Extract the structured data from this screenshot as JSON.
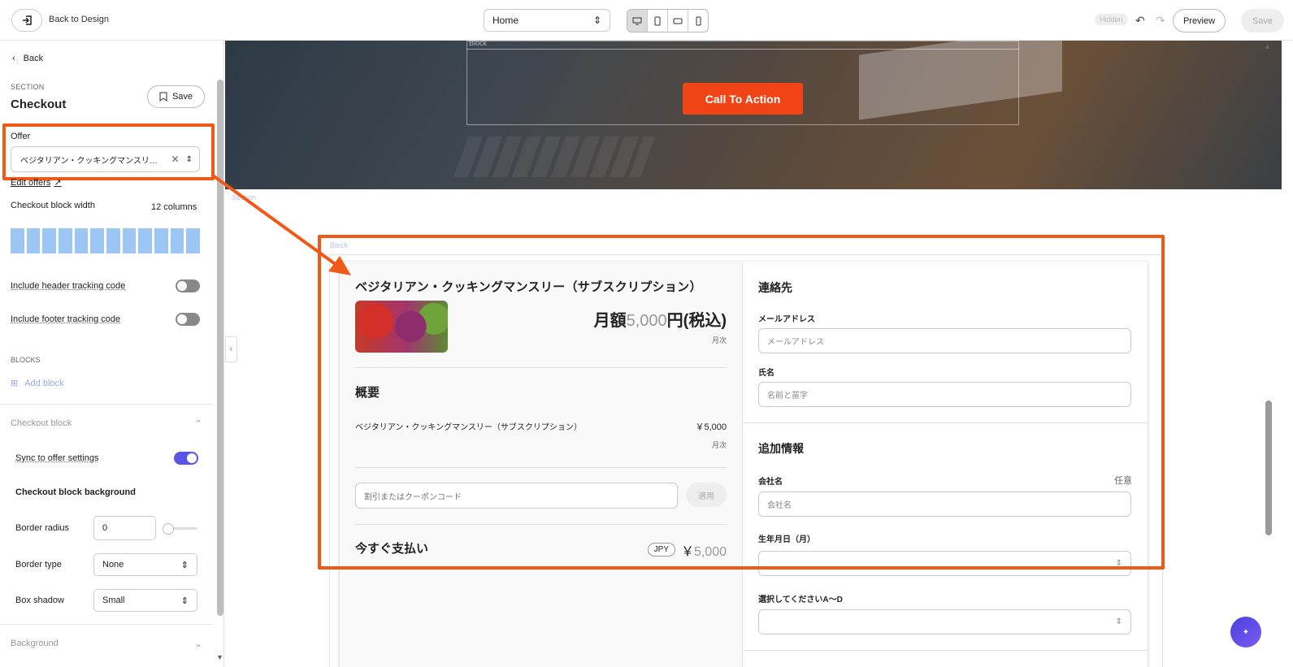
{
  "topbar": {
    "back_to_design": "Back to Design",
    "page_select": "Home",
    "hidden_badge": "Hidden",
    "preview": "Preview",
    "save": "Save"
  },
  "sidebar": {
    "back": "Back",
    "section_caption": "SECTION",
    "section_title": "Checkout",
    "save": "Save",
    "offer_label": "Offer",
    "offer_value": "ベジタリアン・クッキングマンスリー（サ...",
    "edit_offers": "Edit offers",
    "checkout_block_width_label": "Checkout block width",
    "checkout_block_width_value": "12 columns",
    "columns": 12,
    "include_header_tracking": "Include header tracking code",
    "include_footer_tracking": "Include footer tracking code",
    "blocks_caption": "BLOCKS",
    "add_block": "Add block",
    "checkout_block_header": "Checkout block",
    "sync_to_offer": "Sync to offer settings",
    "checkout_block_background": "Checkout block background",
    "border_radius_label": "Border radius",
    "border_radius_value": "0",
    "border_type_label": "Border type",
    "border_type_value": "None",
    "box_shadow_label": "Box shadow",
    "box_shadow_value": "Small",
    "background_header": "Background"
  },
  "canvas": {
    "block_tag": "Block",
    "section_tag": "Section",
    "cta": "Call To Action"
  },
  "checkout": {
    "product_title": "ベジタリアン・クッキングマンスリー（サブスクリプション）",
    "price_prefix": "月額",
    "price_amount": "5,000",
    "price_suffix": "円(税込)",
    "price_period": "月次",
    "summary_title": "概要",
    "line_name": "ベジタリアン・クッキングマンスリー（サブスクリプション）",
    "line_price": "￥5,000",
    "line_period": "月次",
    "coupon_placeholder": "割引またはクーポンコード",
    "apply": "適用",
    "pay_now": "今すぐ支払い",
    "currency": "JPY",
    "total_symbol": "￥",
    "total_amount": "5,000",
    "contact_title": "連絡先",
    "email_label": "メールアドレス",
    "email_placeholder": "メールアドレス",
    "name_label": "氏名",
    "name_placeholder": "名前と苗字",
    "additional_title": "追加情報",
    "company_label": "会社名",
    "optional": "任意",
    "company_placeholder": "会社名",
    "dob_label": "生年月日（月）",
    "choose_label": "選択してくださいA〜D"
  },
  "colors": {
    "accent": "#f05a16",
    "cta": "#f04417",
    "toggle_on": "#5b55e6",
    "columns": "#9cc7f5"
  }
}
